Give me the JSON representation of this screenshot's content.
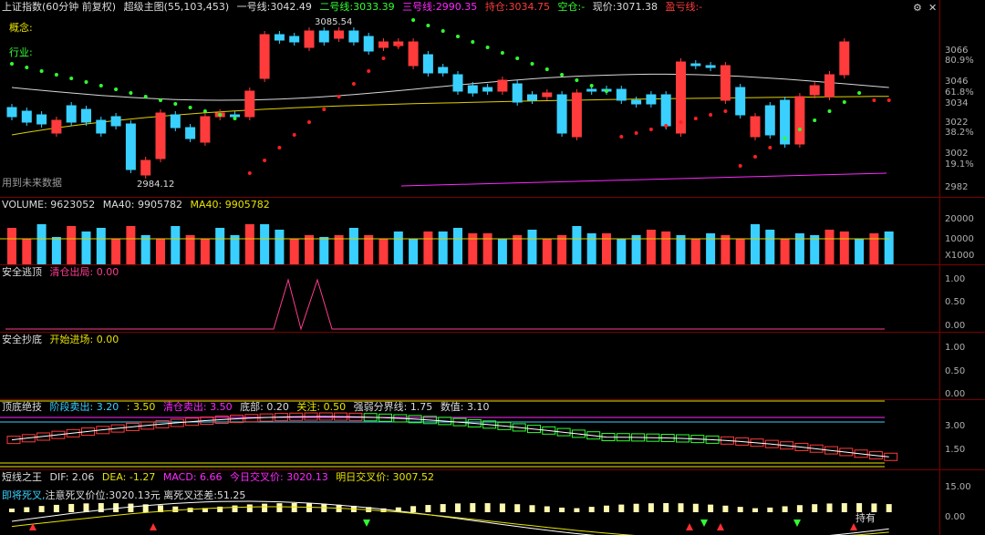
{
  "main": {
    "title": "上证指数(60分钟 前复权)",
    "indicator": "超级主图(55,103,453)",
    "line1_label": "一号线:",
    "line1_value": "3042.49",
    "line2_label": "二号线:",
    "line2_value": "3033.39",
    "line3_label": "三号线:",
    "line3_value": "2990.35",
    "hold_label": "持仓:",
    "hold_value": "3034.75",
    "empty_label": "空仓:",
    "empty_value": "-",
    "price_label": "现价:",
    "price_value": "3071.38",
    "profit_label": "盈亏线:",
    "profit_value": "-",
    "concept_label": "概念:",
    "industry_label": "行业:",
    "future_note": "用到未来数据",
    "high_annotation": "3085.54",
    "low_annotation": "2984.12",
    "y_labels": [
      "3066",
      "80.9%",
      "3046",
      "61.8%",
      "3034",
      "3022",
      "38.2%",
      "3002",
      "19.1%",
      "2982"
    ],
    "controls": {
      "settings": "⚙",
      "close": "✕"
    }
  },
  "volume": {
    "title": "VOLUME:",
    "value": "9623052",
    "ma_label": "MA40:",
    "ma_value": "9905782",
    "ma_label2": "MA40:",
    "ma_value2": "9905782",
    "y_labels": [
      "20000",
      "10000",
      "X1000"
    ]
  },
  "escape": {
    "title": "安全逃顶",
    "signal_label": "清仓出局:",
    "signal_value": "0.00",
    "y_labels": [
      "1.00",
      "0.50",
      "0.00"
    ]
  },
  "bottom": {
    "title": "安全抄底",
    "signal_label": "开始进场:",
    "signal_value": "0.00",
    "y_labels": [
      "1.00",
      "0.50",
      "0.00"
    ]
  },
  "topbottom": {
    "title": "顶底绝技",
    "stage_label": "阶段卖出:",
    "stage_value1": "3.20",
    "stage_sep": ":",
    "stage_value2": "3.50",
    "clear_label": "清仓卖出:",
    "clear_value": "3.50",
    "base_label": "底部:",
    "base_value": "0.20",
    "focus_label": "关注:",
    "focus_value": "0.50",
    "strength_label": "强弱分界线:",
    "strength_value": "1.75",
    "value_label": "数值:",
    "value_value": "3.10",
    "y_labels": [
      "3.00",
      "1.50"
    ]
  },
  "short": {
    "title": "短线之王",
    "dif_label": "DIF:",
    "dif_value": "2.06",
    "dea_label": "DEA:",
    "dea_value": "-1.27",
    "macd_label": "MACD:",
    "macd_value": "6.66",
    "today_label": "今日交叉价:",
    "today_value": "3020.13",
    "tomorrow_label": "明日交叉价:",
    "tomorrow_value": "3007.52",
    "note_prefix": "即将死叉,",
    "note_price": "注意死叉价位:3020.13元",
    "note_diff": "离死叉还差:51.25",
    "hold_tag": "持有",
    "y_labels": [
      "15.00",
      "0.00"
    ]
  },
  "colors": {
    "up": "#ff3b3b",
    "down": "#39d0ff",
    "ma_white": "#d8d8d8",
    "ma_yellow": "#e0d000",
    "sar_red": "#ff2020",
    "sar_green": "#30ff30",
    "magenta": "#ff28ff"
  }
}
